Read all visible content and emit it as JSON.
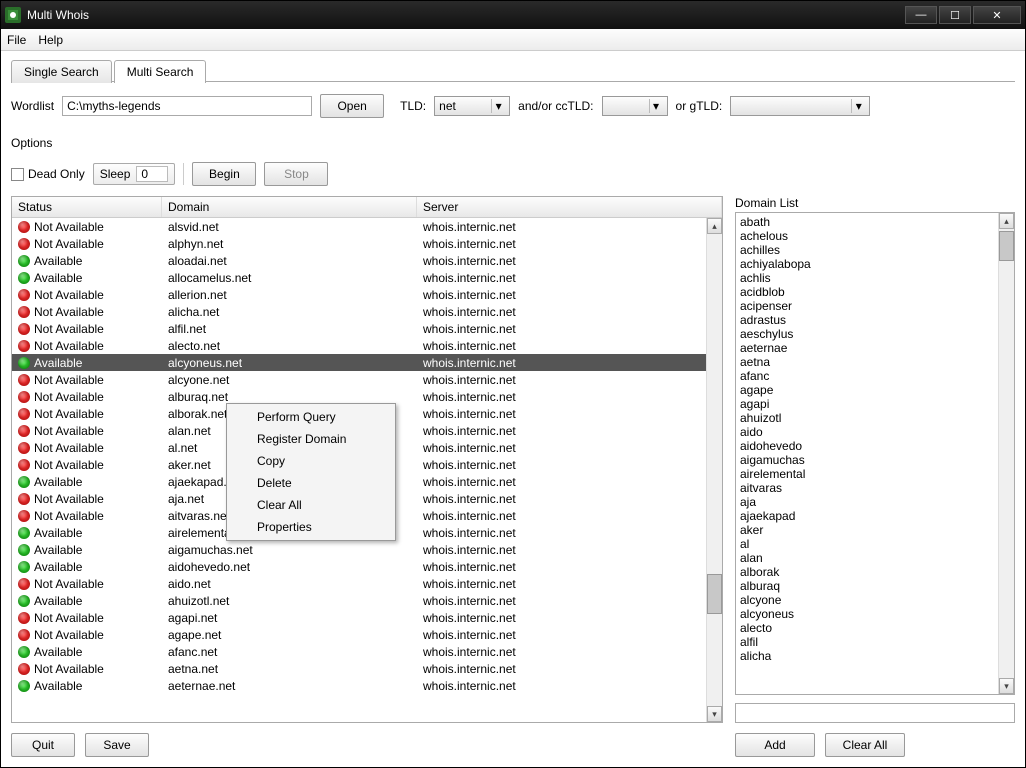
{
  "window": {
    "title": "Multi Whois"
  },
  "menubar": {
    "file": "File",
    "help": "Help"
  },
  "tabs": {
    "single": "Single Search",
    "multi": "Multi Search"
  },
  "toolbar": {
    "wordlist_label": "Wordlist",
    "wordlist_value": "C:\\myths-legends",
    "open_label": "Open",
    "tld_label": "TLD:",
    "tld_value": "net",
    "cc_label": "and/or ccTLD:",
    "cc_value": "",
    "g_label": "or gTLD:",
    "g_value": ""
  },
  "options": {
    "label": "Options",
    "dead_only": "Dead Only",
    "sleep_label": "Sleep",
    "sleep_value": "0",
    "begin": "Begin",
    "stop": "Stop"
  },
  "headers": {
    "status": "Status",
    "domain": "Domain",
    "server": "Server"
  },
  "rows": [
    {
      "status": "Not Available",
      "color": "red",
      "domain": "alsvid.net",
      "server": "whois.internic.net"
    },
    {
      "status": "Not Available",
      "color": "red",
      "domain": "alphyn.net",
      "server": "whois.internic.net"
    },
    {
      "status": "Available",
      "color": "green",
      "domain": "aloadai.net",
      "server": "whois.internic.net"
    },
    {
      "status": "Available",
      "color": "green",
      "domain": "allocamelus.net",
      "server": "whois.internic.net"
    },
    {
      "status": "Not Available",
      "color": "red",
      "domain": "allerion.net",
      "server": "whois.internic.net"
    },
    {
      "status": "Not Available",
      "color": "red",
      "domain": "alicha.net",
      "server": "whois.internic.net"
    },
    {
      "status": "Not Available",
      "color": "red",
      "domain": "alfil.net",
      "server": "whois.internic.net"
    },
    {
      "status": "Not Available",
      "color": "red",
      "domain": "alecto.net",
      "server": "whois.internic.net"
    },
    {
      "status": "Available",
      "color": "green",
      "domain": "alcyoneus.net",
      "server": "whois.internic.net",
      "selected": true
    },
    {
      "status": "Not Available",
      "color": "red",
      "domain": "alcyone.net",
      "server": "whois.internic.net"
    },
    {
      "status": "Not Available",
      "color": "red",
      "domain": "alburaq.net",
      "server": "whois.internic.net"
    },
    {
      "status": "Not Available",
      "color": "red",
      "domain": "alborak.net",
      "server": "whois.internic.net"
    },
    {
      "status": "Not Available",
      "color": "red",
      "domain": "alan.net",
      "server": "whois.internic.net"
    },
    {
      "status": "Not Available",
      "color": "red",
      "domain": "al.net",
      "server": "whois.internic.net"
    },
    {
      "status": "Not Available",
      "color": "red",
      "domain": "aker.net",
      "server": "whois.internic.net"
    },
    {
      "status": "Available",
      "color": "green",
      "domain": "ajaekapad.net",
      "server": "whois.internic.net"
    },
    {
      "status": "Not Available",
      "color": "red",
      "domain": "aja.net",
      "server": "whois.internic.net"
    },
    {
      "status": "Not Available",
      "color": "red",
      "domain": "aitvaras.net",
      "server": "whois.internic.net"
    },
    {
      "status": "Available",
      "color": "green",
      "domain": "airelemental.net",
      "server": "whois.internic.net"
    },
    {
      "status": "Available",
      "color": "green",
      "domain": "aigamuchas.net",
      "server": "whois.internic.net"
    },
    {
      "status": "Available",
      "color": "green",
      "domain": "aidohevedo.net",
      "server": "whois.internic.net"
    },
    {
      "status": "Not Available",
      "color": "red",
      "domain": "aido.net",
      "server": "whois.internic.net"
    },
    {
      "status": "Available",
      "color": "green",
      "domain": "ahuizotl.net",
      "server": "whois.internic.net"
    },
    {
      "status": "Not Available",
      "color": "red",
      "domain": "agapi.net",
      "server": "whois.internic.net"
    },
    {
      "status": "Not Available",
      "color": "red",
      "domain": "agape.net",
      "server": "whois.internic.net"
    },
    {
      "status": "Available",
      "color": "green",
      "domain": "afanc.net",
      "server": "whois.internic.net"
    },
    {
      "status": "Not Available",
      "color": "red",
      "domain": "aetna.net",
      "server": "whois.internic.net"
    },
    {
      "status": "Available",
      "color": "green",
      "domain": "aeternae.net",
      "server": "whois.internic.net"
    }
  ],
  "context_menu": {
    "items": [
      "Perform Query",
      "Register Domain",
      "Copy",
      "Delete",
      "Clear All",
      "Properties"
    ]
  },
  "domain_list": {
    "label": "Domain List",
    "items": [
      "abath",
      "achelous",
      "achilles",
      "achiyalabopa",
      "achlis",
      "acidblob",
      "acipenser",
      "adrastus",
      "aeschylus",
      "aeternae",
      "aetna",
      "afanc",
      "agape",
      "agapi",
      "ahuizotl",
      "aido",
      "aidohevedo",
      "aigamuchas",
      "airelemental",
      "aitvaras",
      "aja",
      "ajaekapad",
      "aker",
      "al",
      "alan",
      "alborak",
      "alburaq",
      "alcyone",
      "alcyoneus",
      "alecto",
      "alfil",
      "alicha"
    ],
    "add": "Add",
    "clear": "Clear All"
  },
  "bottom": {
    "quit": "Quit",
    "save": "Save"
  }
}
